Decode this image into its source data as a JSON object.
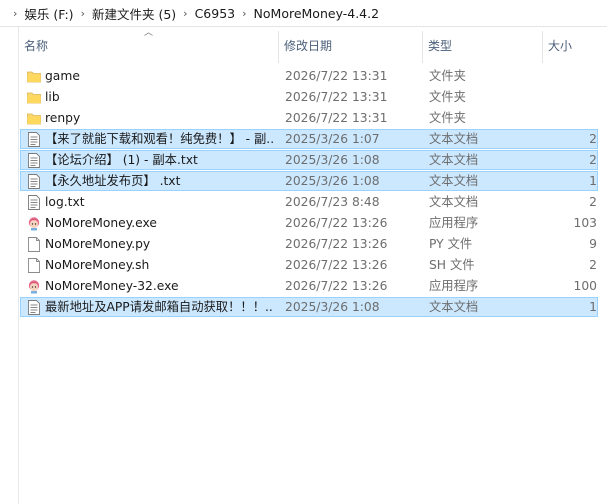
{
  "breadcrumb": {
    "items": [
      "娱乐 (F:)",
      "新建文件夹 (5)",
      "C6953",
      "NoMoreMoney-4.4.2"
    ],
    "separator": "›"
  },
  "columns": {
    "name": "名称",
    "date": "修改日期",
    "type": "类型",
    "size": "大小"
  },
  "files": [
    {
      "name": "game",
      "date": "2026/7/22 13:31",
      "type": "文件夹",
      "size": "",
      "icon": "folder-icon",
      "selected": false
    },
    {
      "name": "lib",
      "date": "2026/7/22 13:31",
      "type": "文件夹",
      "size": "",
      "icon": "folder-icon",
      "selected": false
    },
    {
      "name": "renpy",
      "date": "2026/7/22 13:31",
      "type": "文件夹",
      "size": "",
      "icon": "folder-icon",
      "selected": false
    },
    {
      "name": "【来了就能下载和观看！纯免费！】 - 副...",
      "date": "2025/3/26 1:07",
      "type": "文本文档",
      "size": "2",
      "icon": "text-file-icon",
      "selected": true
    },
    {
      "name": "【论坛介绍】 (1) - 副本.txt",
      "date": "2025/3/26 1:08",
      "type": "文本文档",
      "size": "2",
      "icon": "text-file-icon",
      "selected": true
    },
    {
      "name": "【永久地址发布页】 .txt",
      "date": "2025/3/26 1:08",
      "type": "文本文档",
      "size": "1",
      "icon": "text-file-icon",
      "selected": true
    },
    {
      "name": "log.txt",
      "date": "2026/7/23 8:48",
      "type": "文本文档",
      "size": "2",
      "icon": "text-file-icon",
      "selected": false
    },
    {
      "name": "NoMoreMoney.exe",
      "date": "2026/7/22 13:26",
      "type": "应用程序",
      "size": "103",
      "icon": "renpy-app-icon",
      "selected": false
    },
    {
      "name": "NoMoreMoney.py",
      "date": "2026/7/22 13:26",
      "type": "PY 文件",
      "size": "9",
      "icon": "blank-file-icon",
      "selected": false
    },
    {
      "name": "NoMoreMoney.sh",
      "date": "2026/7/22 13:26",
      "type": "SH 文件",
      "size": "2",
      "icon": "blank-file-icon",
      "selected": false
    },
    {
      "name": "NoMoreMoney-32.exe",
      "date": "2026/7/22 13:26",
      "type": "应用程序",
      "size": "100",
      "icon": "renpy-app-icon",
      "selected": false
    },
    {
      "name": "最新地址及APP请发邮箱自动获取！！！...",
      "date": "2025/3/26 1:08",
      "type": "文本文档",
      "size": "1",
      "icon": "text-file-icon",
      "selected": true
    }
  ],
  "colors": {
    "selection_bg": "#cce8ff",
    "selection_border": "#99d1ff",
    "header_text": "#4c607a",
    "folder": "#f8d775"
  }
}
